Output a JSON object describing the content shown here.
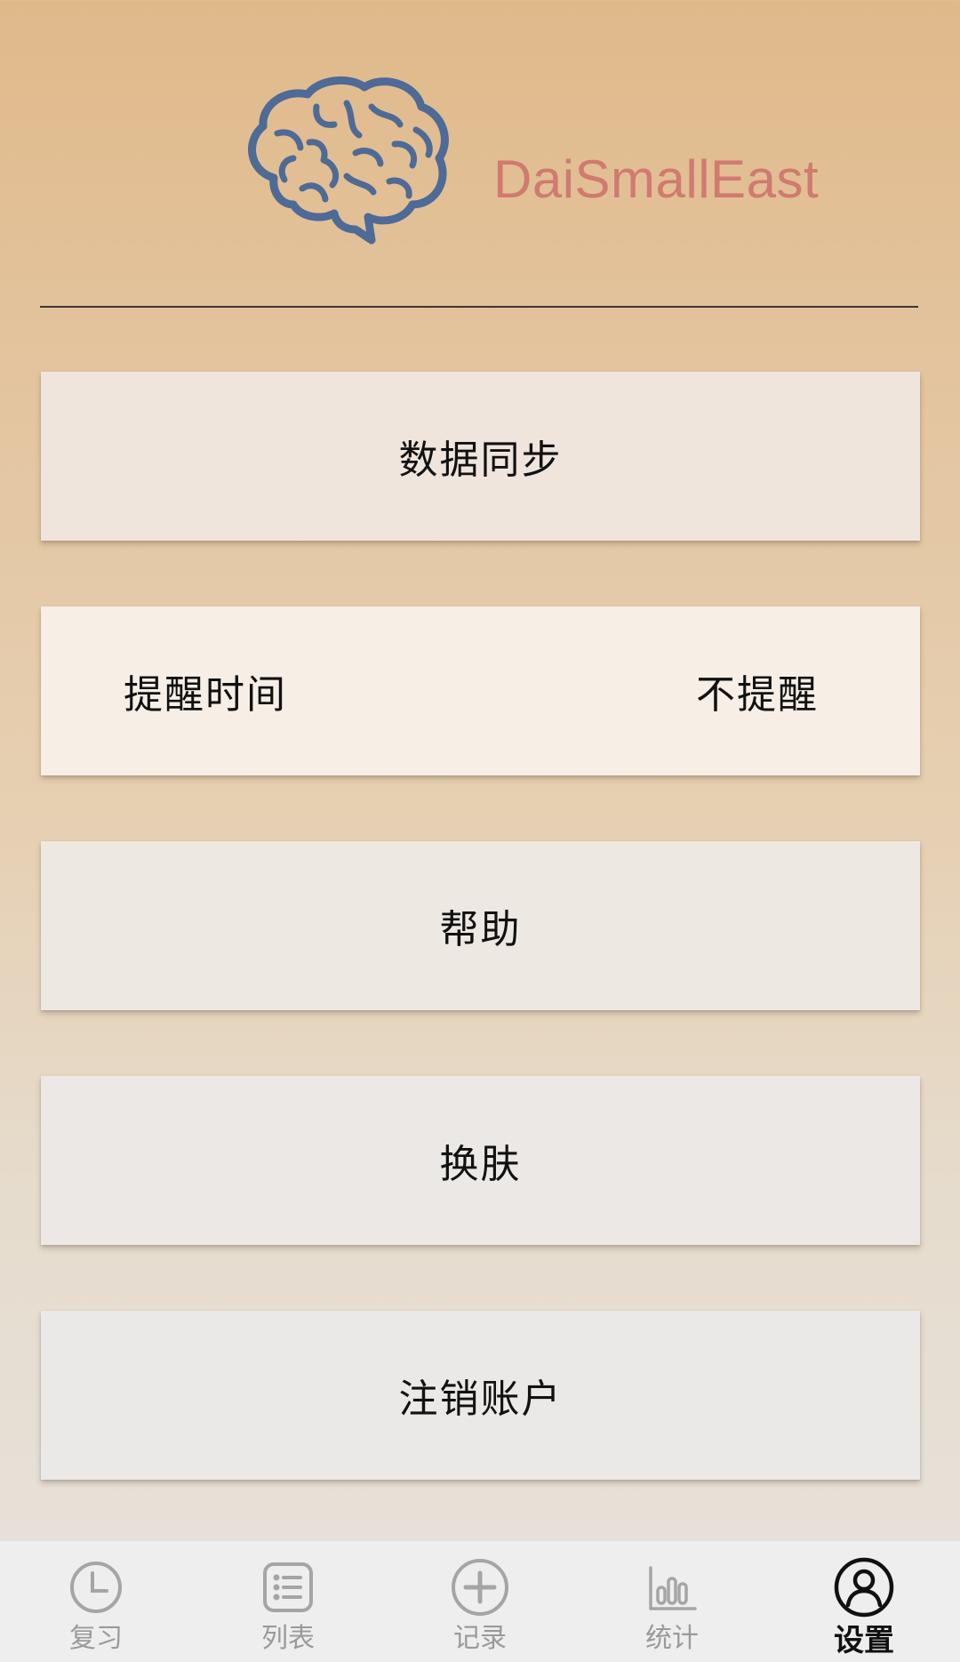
{
  "header": {
    "brand_name": "DaiSmallEast",
    "logo_icon": "brain-icon",
    "logo_color": "#4e6a96",
    "brand_color": "#d07a70"
  },
  "settings": {
    "data_sync": {
      "label": "数据同步"
    },
    "reminder": {
      "label": "提醒时间",
      "value": "不提醒"
    },
    "help": {
      "label": "帮助"
    },
    "skin": {
      "label": "换肤"
    },
    "logout": {
      "label": "注销账户"
    }
  },
  "tabbar": {
    "active_tab": "设置",
    "tabs": [
      {
        "label": "复习",
        "icon": "clock-icon"
      },
      {
        "label": "列表",
        "icon": "list-icon"
      },
      {
        "label": "记录",
        "icon": "plus-circle-icon"
      },
      {
        "label": "统计",
        "icon": "bar-chart-icon"
      },
      {
        "label": "设置",
        "icon": "user-circle-icon"
      }
    ]
  }
}
